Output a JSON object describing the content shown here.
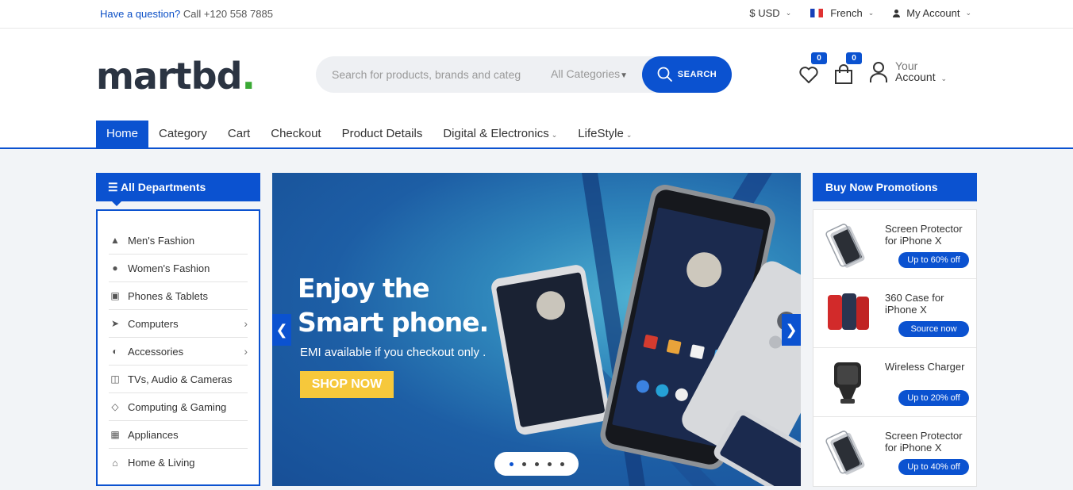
{
  "topbar": {
    "question": "Have a question?",
    "phone": "Call +120 558 7885",
    "currency": "$ USD",
    "language": "French",
    "account": "My Account"
  },
  "header": {
    "logo": "martbd",
    "logo_dot": ".",
    "search_placeholder": "Search for products, brands and categ",
    "category_select": "All Categories",
    "search_button": "SEARCH",
    "wishlist_count": "0",
    "cart_count": "0",
    "account_line1": "Your",
    "account_line2": "Account"
  },
  "nav": {
    "items": [
      "Home",
      "Category",
      "Cart",
      "Checkout",
      "Product Details",
      "Digital & Electronics",
      "LifeStyle"
    ]
  },
  "departments": {
    "title": "All Departments",
    "items": [
      {
        "label": "Men's Fashion",
        "icon": "shirt-icon"
      },
      {
        "label": "Women's Fashion",
        "icon": "user-icon"
      },
      {
        "label": "Phones & Tablets",
        "icon": "video-icon"
      },
      {
        "label": "Computers",
        "icon": "rocket-icon"
      },
      {
        "label": "Accessories",
        "icon": "globe-icon"
      },
      {
        "label": "TVs, Audio & Cameras",
        "icon": "car-icon"
      },
      {
        "label": "Computing & Gaming",
        "icon": "tag-icon"
      },
      {
        "label": "Appliances",
        "icon": "gift-icon"
      },
      {
        "label": "Home & Living",
        "icon": "home-icon"
      }
    ]
  },
  "slider": {
    "title_line1": "Enjoy the",
    "title_line2": "Smart phone.",
    "subtitle": "EMI available if you checkout only .",
    "button": "SHOP NOW",
    "slides": 5,
    "active_slide": 1
  },
  "promotions": {
    "title": "Buy Now Promotions",
    "items": [
      {
        "title": "Screen Protector for iPhone X",
        "badge": "Up to 60% off"
      },
      {
        "title": "360 Case for iPhone X",
        "badge": "Source now"
      },
      {
        "title": "Wireless Charger",
        "badge": "Up to 20% off"
      },
      {
        "title": "Screen Protector for iPhone X",
        "badge": "Up to 40% off"
      }
    ]
  },
  "colors": {
    "primary": "#0b52d0",
    "logo_dot": "#3aa935",
    "shop_button": "#f6c83b"
  }
}
